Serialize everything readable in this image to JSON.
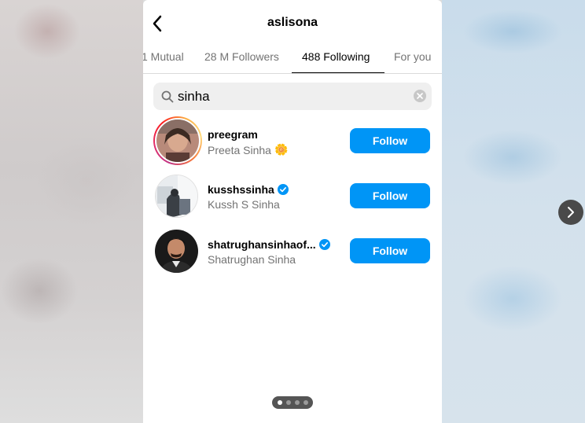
{
  "header": {
    "title": "aslisona"
  },
  "tabs": [
    {
      "label": "1 Mutual"
    },
    {
      "label": "28 M Followers"
    },
    {
      "label": "488 Following"
    },
    {
      "label": "For you"
    }
  ],
  "search": {
    "value": "sinha"
  },
  "results": [
    {
      "username": "preegram",
      "full_name": "Preeta Sinha",
      "emoji": "🌼",
      "verified": false,
      "button": "Follow",
      "has_story_ring": true
    },
    {
      "username": "kusshssinha",
      "full_name": "Kussh S Sinha",
      "verified": true,
      "button": "Follow"
    },
    {
      "username": "shatrughansinhaof...",
      "full_name": "Shatrughan Sinha",
      "verified": true,
      "button": "Follow"
    }
  ],
  "pager": {
    "count": 4,
    "active": 0
  },
  "colors": {
    "follow_blue": "#0095f6",
    "verified_blue": "#0095f6"
  },
  "icons": [
    "back-arrow-icon",
    "search-icon",
    "clear-icon",
    "verified-badge-icon",
    "chevron-right-icon"
  ]
}
